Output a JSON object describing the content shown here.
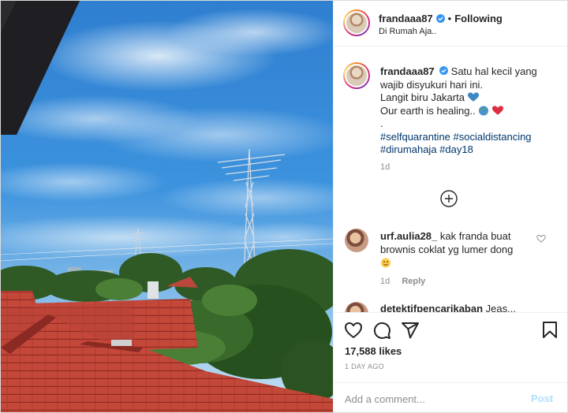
{
  "post": {
    "username": "frandaaa87",
    "verified": true,
    "separator": "•",
    "follow_state": "Following",
    "location": "Di Rumah Aja..",
    "caption": {
      "username": "frandaaa87",
      "lines": [
        "Satu hal kecil yang",
        "wajib disyukuri hari ini.",
        "Langit biru Jakarta",
        "Our earth is healing..",
        "."
      ],
      "hashtags_line1": [
        "#selfquarantine",
        "#socialdistancing"
      ],
      "hashtags_line2": [
        "#dirumahaja",
        "#day18"
      ],
      "time": "1d"
    },
    "comments": [
      {
        "username": "urf.aulia28_",
        "text_line1": "kak franda buat",
        "text_line2": "brownis coklat yg lumer dong",
        "time": "1d",
        "reply_label": "Reply"
      },
      {
        "username": "detektifpencarikaban",
        "text": "Jeas..."
      }
    ],
    "likes": "17,588 likes",
    "time_ago": "1 DAY AGO",
    "add_comment_placeholder": "Add a comment...",
    "post_button": "Post"
  },
  "icons": {
    "header_avatar": "profile-avatar",
    "verified": "verified-badge-icon",
    "more": "plus-circle-icon",
    "like": "heart-icon",
    "comment": "comment-bubble-icon",
    "share": "paper-plane-icon",
    "save": "bookmark-icon",
    "emojis": [
      "blue-heart-emoji",
      "globe-emoji",
      "red-heart-emoji",
      "smile-emoji"
    ]
  },
  "colors": {
    "link": "#00376b",
    "verified": "#3897f0",
    "post_button": "#b2dffc",
    "secondary_text": "#8e8e8e"
  }
}
